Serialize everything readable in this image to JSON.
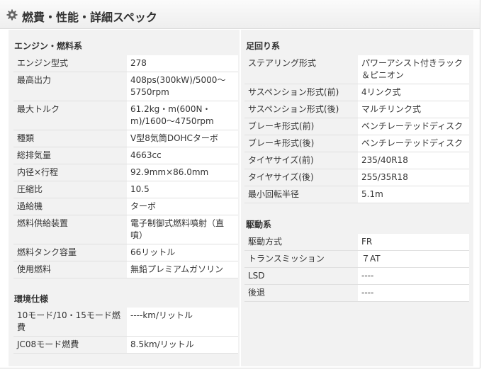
{
  "header": {
    "title": "燃費・性能・詳細スペック",
    "icon": "gear-icon"
  },
  "colors": {
    "panel_bg": "#f2f2f2",
    "value_bg": "#ffffff",
    "text": "#333333"
  },
  "sections": {
    "engine": {
      "title": "エンジン・燃料系",
      "rows": [
        {
          "label": "エンジン型式",
          "value": "278"
        },
        {
          "label": "最高出力",
          "value": "408ps(300kW)/5000～5750rpm"
        },
        {
          "label": "最大トルク",
          "value": "61.2kg・m(600N・m)/1600～4750rpm"
        },
        {
          "label": "種類",
          "value": "V型8気筒DOHCターボ"
        },
        {
          "label": "総排気量",
          "value": "4663cc"
        },
        {
          "label": "内径×行程",
          "value": "92.9mm×86.0mm"
        },
        {
          "label": "圧縮比",
          "value": "10.5"
        },
        {
          "label": "過給機",
          "value": "ターボ"
        },
        {
          "label": "燃料供給装置",
          "value": "電子制御式燃料噴射（直噴）"
        },
        {
          "label": "燃料タンク容量",
          "value": "66リットル"
        },
        {
          "label": "使用燃料",
          "value": "無鉛プレミアムガソリン"
        }
      ]
    },
    "environment": {
      "title": "環境仕様",
      "rows": [
        {
          "label": "10モード/10・15モード燃費",
          "value": "----km/リットル"
        },
        {
          "label": "JC08モード燃費",
          "value": "8.5km/リットル"
        }
      ]
    },
    "suspension": {
      "title": "足回り系",
      "rows": [
        {
          "label": "ステアリング形式",
          "value": "パワーアシスト付きラック＆ピニオン"
        },
        {
          "label": "サスペンション形式(前)",
          "value": "4リンク式"
        },
        {
          "label": "サスペンション形式(後)",
          "value": "マルチリンク式"
        },
        {
          "label": "ブレーキ形式(前)",
          "value": "ベンチレーテッドディスク"
        },
        {
          "label": "ブレーキ形式(後)",
          "value": "ベンチレーテッドディスク"
        },
        {
          "label": "タイヤサイズ(前)",
          "value": "235/40R18"
        },
        {
          "label": "タイヤサイズ(後)",
          "value": "255/35R18"
        },
        {
          "label": "最小回転半径",
          "value": "5.1m"
        }
      ]
    },
    "drive": {
      "title": "駆動系",
      "rows": [
        {
          "label": "駆動方式",
          "value": "FR"
        },
        {
          "label": "トランスミッション",
          "value": "７AT"
        },
        {
          "label": "LSD",
          "value": "----"
        },
        {
          "label": "後退",
          "value": "----"
        }
      ]
    }
  }
}
